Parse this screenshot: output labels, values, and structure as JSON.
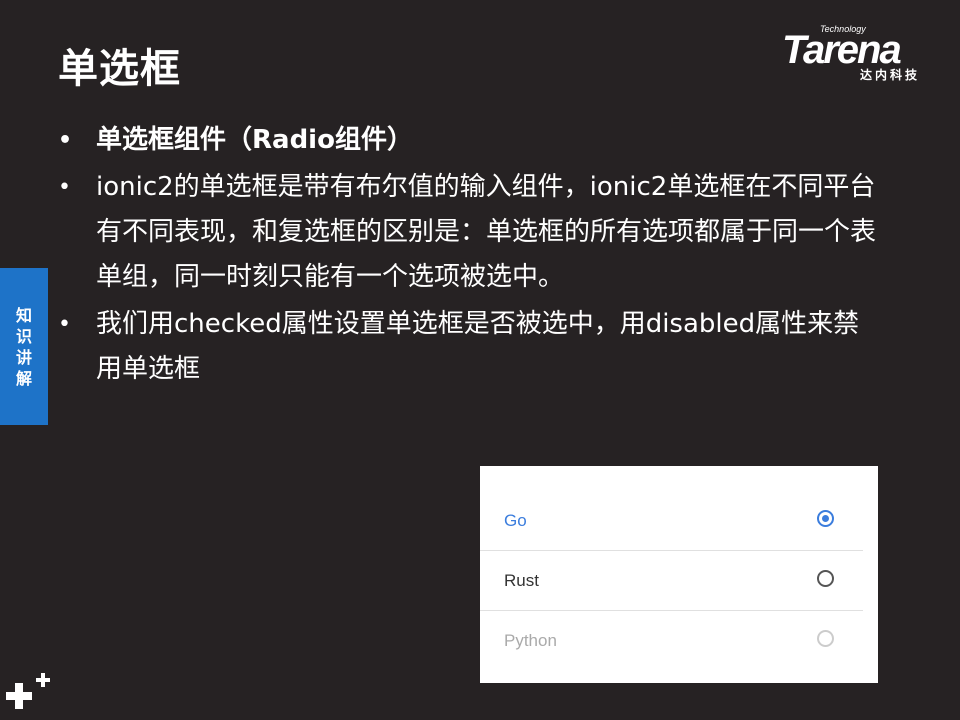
{
  "slide": {
    "title": "单选框",
    "side_tab": [
      "知",
      "识",
      "讲",
      "解"
    ],
    "bullet_symbol": "•",
    "bullets": [
      "单选框组件（Radio组件）",
      "ionic2的单选框是带有布尔值的输入组件，ionic2单选框在不同平台有不同表现，和复选框的区别是：单选框的所有选项都属于同一个表单组，同一时刻只能有一个选项被选中。",
      "我们用checked属性设置单选框是否被选中，用disabled属性来禁用单选框"
    ]
  },
  "logo": {
    "brand": "Tarena",
    "tagline": "Technology",
    "chinese": "达内科技"
  },
  "radio_demo": {
    "options": [
      {
        "label": "Go",
        "checked": true,
        "disabled": false
      },
      {
        "label": "Rust",
        "checked": false,
        "disabled": false
      },
      {
        "label": "Python",
        "checked": false,
        "disabled": true
      }
    ],
    "colors": {
      "accent": "#3b7ddd",
      "text": "#333333",
      "disabled": "#aaaaaa",
      "side_tab": "#1e73c8",
      "background": "#262223"
    }
  }
}
